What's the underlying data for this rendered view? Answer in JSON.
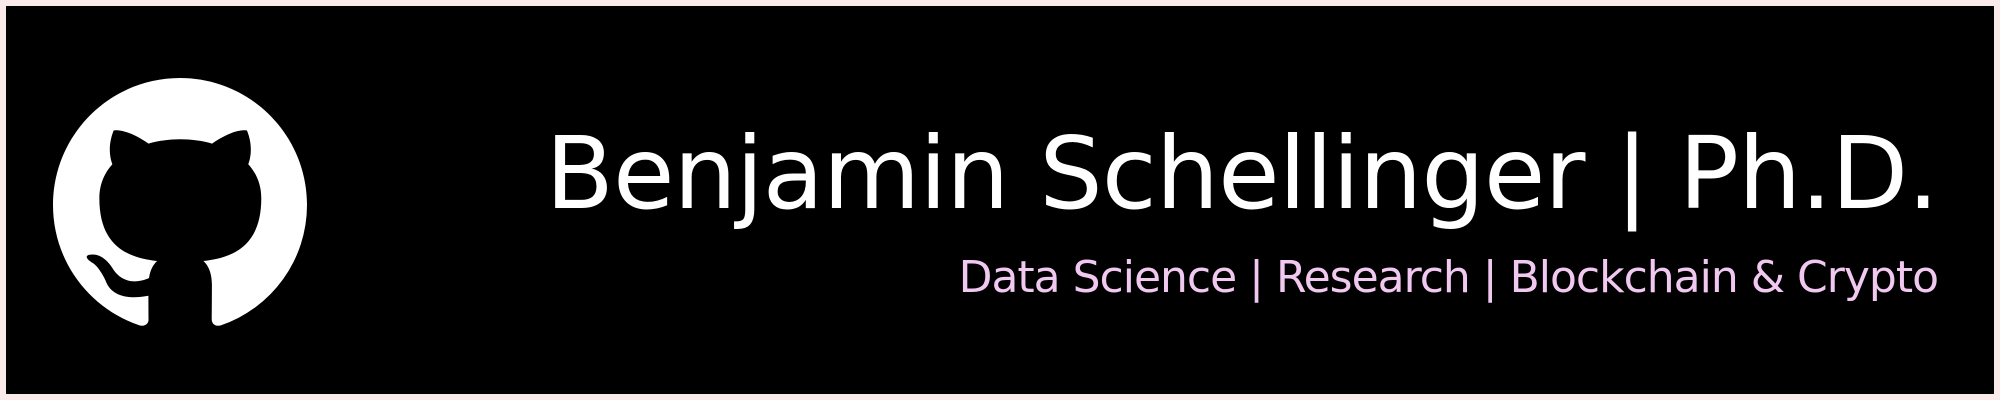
{
  "banner": {
    "title": "Benjamin Schellinger | Ph.D.",
    "subtitle": "Data Science | Research | Blockchain & Crypto",
    "logo_icon": "github-octocat-icon"
  },
  "colors": {
    "page_border": "#fbeaea",
    "background": "#000000",
    "title": "#ffffff",
    "subtitle": "#f0c8f0",
    "logo": "#ffffff"
  }
}
